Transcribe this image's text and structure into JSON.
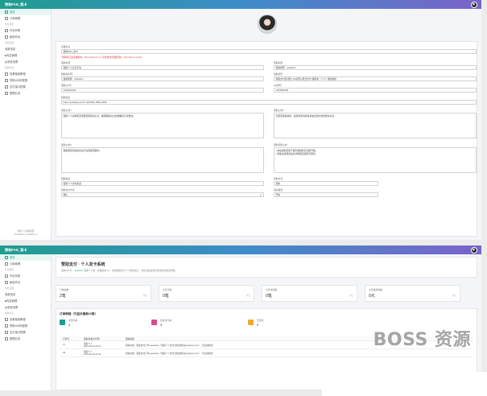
{
  "app": {
    "brand": "赞助FAN_菜卡",
    "accent": "#1f9d8f"
  },
  "sidebar": {
    "items_a": [
      {
        "label": "首页",
        "icon": "home-icon"
      },
      {
        "label": "订单管理",
        "icon": "list-icon"
      }
    ],
    "group1": "外包项目",
    "items_b": [
      {
        "label": "外包列表",
        "icon": "doc-icon"
      },
      {
        "label": "新增外包",
        "icon": "plus-icon"
      }
    ],
    "group2": "功能设置",
    "items_c": [
      {
        "label": "收款信息",
        "icon": "wallet-icon"
      },
      {
        "label": "■内容管理",
        "icon": "content-icon"
      },
      {
        "label": "▥系统设置",
        "icon": "settings-icon"
      }
    ],
    "group3": "其他信息",
    "items_d": [
      {
        "label": "查看使用教程",
        "icon": "user-icon"
      },
      {
        "label": "赞助UID码配置",
        "icon": "qr-icon"
      },
      {
        "label": "支付接口配置",
        "icon": "pay-icon"
      },
      {
        "label": "整理业务",
        "icon": "tools-icon"
      }
    ],
    "footer_a": "赞助个人资料配置",
    "footer_b": "Powered by yaobaotu.cn"
  },
  "profile": {
    "sections": [
      {
        "label": "基础信息",
        "value": "赞助FAN_菜卡"
      }
    ],
    "warn_text": "*赞助接口由系统提供 - http://www.xxx.xx 请勿修改(重要配置) - http://fan.xx.xx/api",
    "rows": [
      {
        "l1": "赞助名称",
        "v1": "赞助个人信息平台",
        "l2": "赞助标题",
        "v2": "赞助昵称 : yaobaotu"
      },
      {
        "l1": "赞助者名称",
        "v1": "赞助昵称 : yaobaotu",
        "l2": "赞助标签",
        "v2": "赞助支付宝·微信·QQ钱包+聚合支付·赞助者（个人）·赞助发起"
      },
      {
        "l1": "赞助QQ号",
        "v1": "1234562345",
        "l2": "QQ群号",
        "v2": "1234562345"
      }
    ],
    "url_label": "赞助链接",
    "url_value": "https://yaobaotu.cn/?c=123780+7863+2456",
    "ta_rows": [
      {
        "l1": "赞助公告1",
        "t1": "赞助个人资料配置需要配置相关信息，确保赞助信息的准确性与完整性。",
        "l2": "赞助公告2",
        "t2": "已配置赞助资料，如需修改请前往系统设置中修改相关信息。"
      },
      {
        "l1": "赞助公告3",
        "t1": "赞助配置完成后将显示在赞助页面中。",
        "l2": "赞助须知公告",
        "t2": "• 本站赞助仅用于服务器维护及功能开发。\n• 赞助后请联系站长获取相应权限与服务。"
      }
    ],
    "bottom_rows": [
      {
        "l1": "赞助渠道",
        "v1": "赞助个人支付渠道",
        "l2": "赞助方式",
        "v2": "赞助"
      },
      {
        "l1": "赞助支付方式",
        "v1": "微信",
        "l2": "自动发货",
        "v2": "开启"
      }
    ]
  },
  "dashboard": {
    "title": "赞助支付 · 个人发卡系统",
    "uid_label": "赞助UID号：",
    "uid_value": "yaobaotu",
    "subtitle": "赞助个人版 · 系统版本 3.1 · 使用赞助支付个人收款接口，请在系统设置中配置相关收款参数。",
    "stats": [
      {
        "label": "订单总数",
        "value": "2笔",
        "unit": "总计"
      },
      {
        "label": "今日订单",
        "value": "0笔",
        "unit": "今日"
      },
      {
        "label": "今日交易额",
        "value": "0笔",
        "unit": "今日"
      },
      {
        "label": "今日收款金额",
        "value": "0元",
        "unit": "今日"
      }
    ],
    "orders_title": "订单明细（只显示最新10笔）",
    "order_stats": [
      {
        "label": "全部订单",
        "value": "3",
        "color": "#1f9d8f"
      },
      {
        "label": "待支付订单",
        "value": "3",
        "color": "#d94a8c"
      },
      {
        "label": "已支付",
        "value": "0",
        "color": "#f0a830"
      }
    ],
    "table_headers": [
      "订单号",
      "赞助者/账户名称",
      "赞助描述"
    ],
    "table_rows": [
      {
        "id": "47",
        "who": "赞助个人\n2019-09-16 23:14",
        "desc": "赞助内容：赞助支付订单-yaobaotu（赞助个人支付宝收款测试yaobaotu.com）- 已完成收款"
      },
      {
        "id": "48",
        "who": "赞助个人\n2019-09-16 23:16",
        "desc": "赞助内容：赞助支付订单-yaobaotu（赞助个人支付宝收款测试yaobaotu.com）- 已完成收款"
      }
    ]
  },
  "watermark": "BOSS 资源"
}
